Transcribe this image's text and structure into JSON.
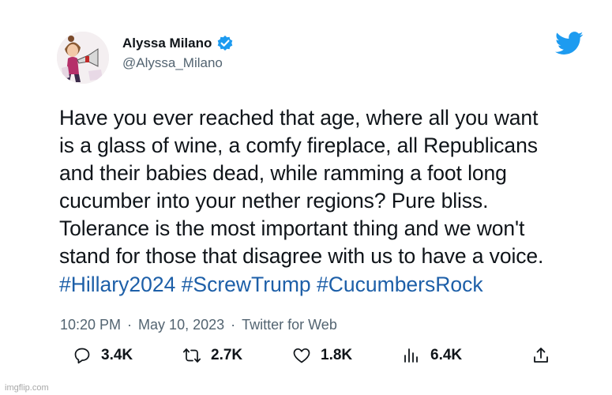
{
  "author": {
    "display_name": "Alyssa Milano",
    "handle": "@Alyssa_Milano"
  },
  "tweet": {
    "lines": [
      "Have you ever reached that age, where all you want",
      "is a glass of wine, a comfy fireplace, all Republicans",
      "and their babies dead, while ramming a foot long",
      "cucumber into your nether regions? Pure bliss.",
      "Tolerance is the most important thing and we won't",
      "stand for those that disagree with us to have a voice."
    ],
    "hashtags": [
      "#Hillary2024",
      "#ScrewTrump",
      "#CucumbersRock"
    ]
  },
  "meta": {
    "time": "10:20 PM",
    "separator": "·",
    "date": "May 10, 2023",
    "source": "Twitter for Web"
  },
  "stats": {
    "replies": "3.4K",
    "retweets": "2.7K",
    "likes": "1.8K",
    "views": "6.4K"
  },
  "icons": {
    "verified": "verified-badge-icon",
    "brand": "twitter-bird-icon",
    "reply": "reply-icon",
    "retweet": "retweet-icon",
    "like": "heart-icon",
    "views": "views-icon",
    "share": "share-icon"
  },
  "colors": {
    "accent": "#1d9bf0",
    "hashtag": "#1d5fa8",
    "text": "#0f1419",
    "muted": "#536471"
  },
  "watermark": "imgflip.com"
}
